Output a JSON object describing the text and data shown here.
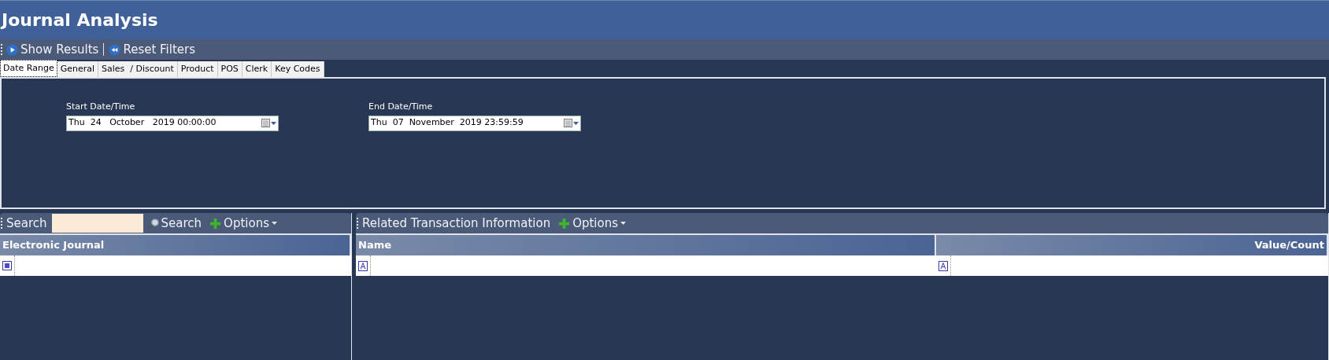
{
  "window": {
    "title": "Journal Analysis"
  },
  "toolbar": [
    {
      "kind": "play",
      "label": "Show Results"
    },
    {
      "kind": "rewind",
      "label": "Reset Filters"
    }
  ],
  "tabs": [
    {
      "label": "Date Range",
      "selected": true
    },
    {
      "label": "General",
      "selected": false
    },
    {
      "label": "Sales  / Discount",
      "selected": false
    },
    {
      "label": "Product",
      "selected": false
    },
    {
      "label": "POS",
      "selected": false
    },
    {
      "label": "Clerk",
      "selected": false
    },
    {
      "label": "Key Codes",
      "selected": false
    }
  ],
  "date_range": [
    {
      "label": "Start Date/Time",
      "value": "Thu  24   October   2019 00:00:00"
    },
    {
      "label": "End Date/Time",
      "value": "Thu  07  November  2019 23:59:59"
    }
  ],
  "left_pane": {
    "search_label": "Search",
    "search_button": "Search",
    "options": "Options",
    "columns": [
      "Electronic Journal"
    ]
  },
  "right_pane": {
    "title": "Related Transaction Information",
    "options": "Options",
    "columns": [
      "Name",
      "Value/Count"
    ]
  }
}
